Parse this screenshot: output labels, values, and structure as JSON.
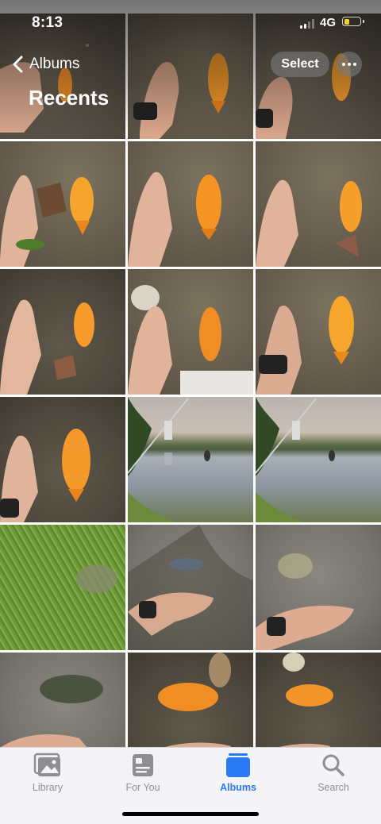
{
  "status_bar": {
    "time": "8:13",
    "network": "4G",
    "battery_level": 0.35,
    "battery_color": "#f5cd2e"
  },
  "nav": {
    "back_label": "Albums",
    "title": "Recents",
    "select_label": "Select"
  },
  "tabs": [
    {
      "label": "Library",
      "icon": "photo-library-icon",
      "active": false
    },
    {
      "label": "For You",
      "icon": "for-you-icon",
      "active": false
    },
    {
      "label": "Albums",
      "icon": "albums-icon",
      "active": true
    },
    {
      "label": "Search",
      "icon": "search-icon",
      "active": false
    }
  ],
  "colors": {
    "accent": "#2a7af5",
    "inactive": "#8e8e93"
  }
}
